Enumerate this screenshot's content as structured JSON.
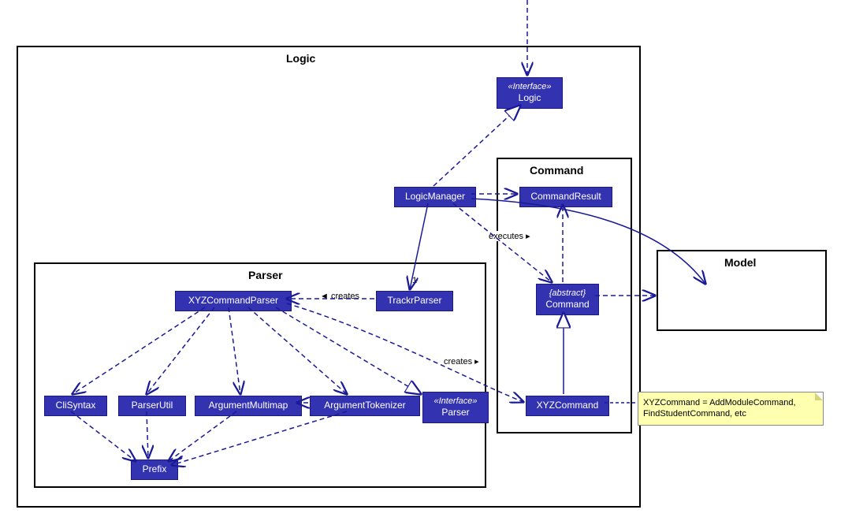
{
  "packages": {
    "logic": {
      "title": "Logic"
    },
    "parser": {
      "title": "Parser"
    },
    "command": {
      "title": "Command"
    },
    "model": {
      "title": "Model"
    }
  },
  "classes": {
    "logicIf": {
      "stereotype": "«Interface»",
      "name": "Logic"
    },
    "logicManager": {
      "name": "LogicManager"
    },
    "trackrParser": {
      "name": "TrackrParser"
    },
    "xyzCommandParser": {
      "name": "XYZCommandParser"
    },
    "cliSyntax": {
      "name": "CliSyntax"
    },
    "parserUtil": {
      "name": "ParserUtil"
    },
    "argMultimap": {
      "name": "ArgumentMultimap"
    },
    "argTokenizer": {
      "name": "ArgumentTokenizer"
    },
    "parserIf": {
      "stereotype": "«Interface»",
      "name": "Parser"
    },
    "prefix": {
      "name": "Prefix"
    },
    "commandResult": {
      "name": "CommandResult"
    },
    "commandAbs": {
      "stereotype": "{abstract}",
      "name": "Command"
    },
    "xyzCommand": {
      "name": "XYZCommand"
    }
  },
  "labels": {
    "creates1": "◄ creates",
    "creates2": "creates ▸",
    "executes": "executes ▸",
    "one": "1"
  },
  "note": {
    "line1": "XYZCommand = AddModuleCommand,",
    "line2": "FindStudentCommand, etc"
  }
}
